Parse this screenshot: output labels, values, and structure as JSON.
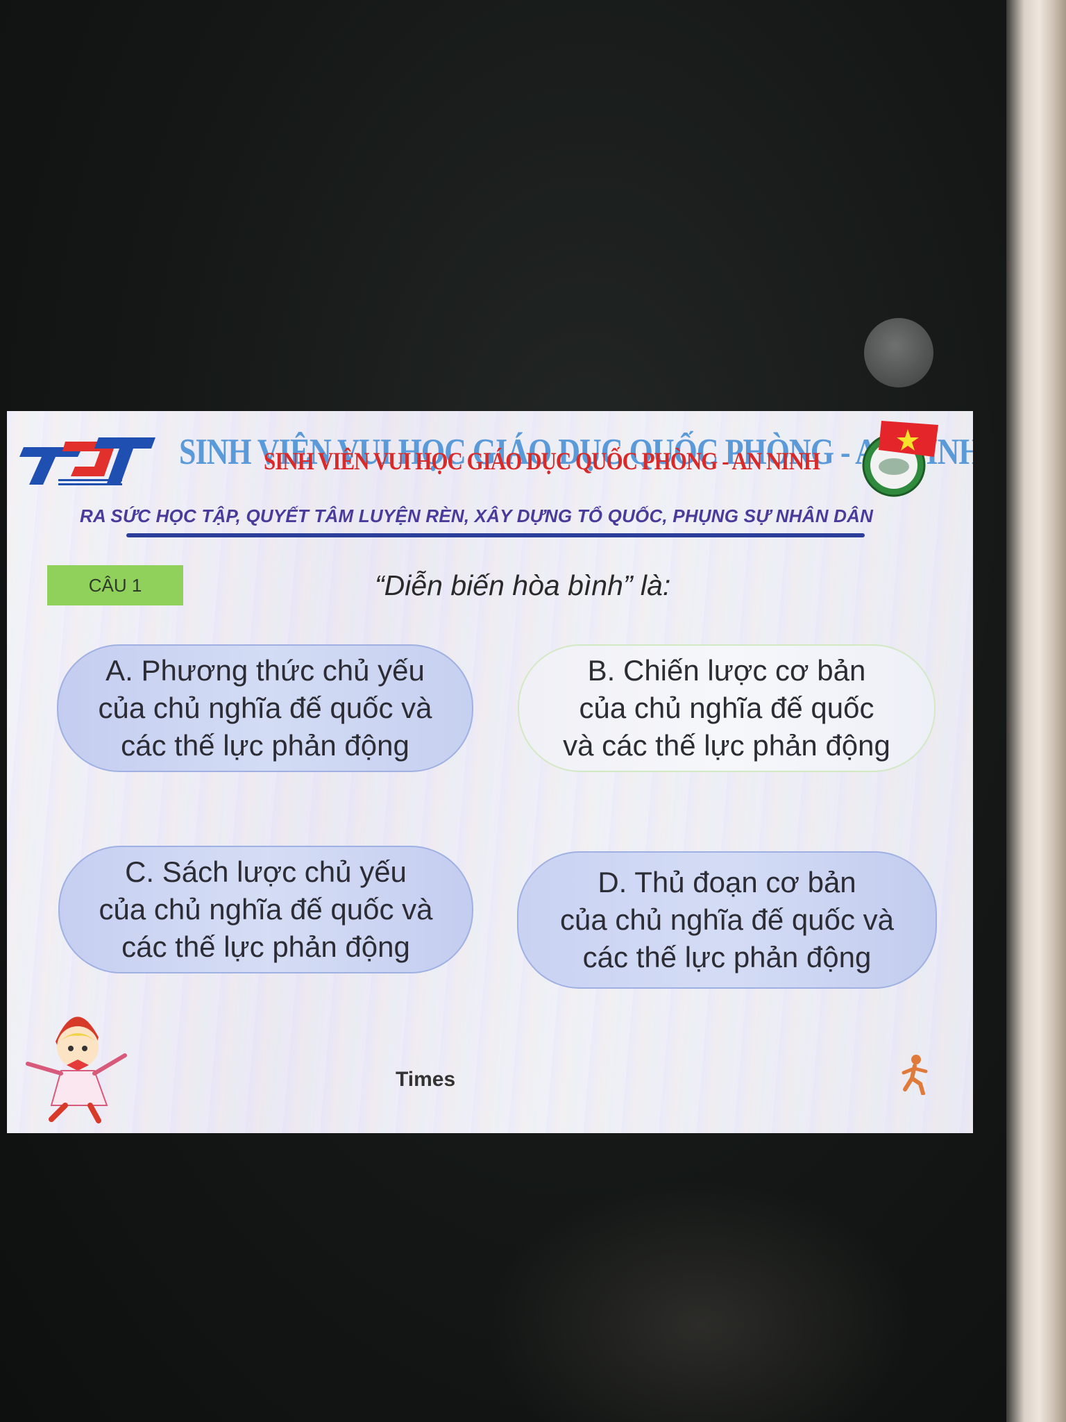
{
  "header": {
    "title": "SINH VIÊN VUI HỌC GIÁO DỤC QUỐC PHÒNG - AN NINH",
    "slogan": "RA SỨC HỌC TẬP, QUYẾT TÂM LUYỆN RÈN, XÂY DỰNG TỔ QUỐC, PHỤNG SỰ NHÂN DÂN",
    "logo": "TDT",
    "emblem_icon": "youth-union-emblem-icon"
  },
  "question": {
    "label": "CÂU 1",
    "text": "“Diễn biến hòa bình” là:"
  },
  "answers": [
    {
      "lines": [
        "A. Phương thức chủ yếu",
        "của chủ nghĩa đế quốc và",
        "các thế lực phản động"
      ]
    },
    {
      "lines": [
        "B. Chiến lược cơ bản",
        "của chủ nghĩa đế quốc",
        "và các thế lực phản động"
      ]
    },
    {
      "lines": [
        "C. Sách lược chủ yếu",
        "của chủ nghĩa đế quốc và",
        "các thế lực phản động"
      ]
    },
    {
      "lines": [
        "D. Thủ đoạn cơ bản",
        "của chủ nghĩa đế quốc và",
        "các thế lực phản động"
      ]
    }
  ],
  "footer": {
    "timer_label": "Times"
  },
  "colors": {
    "badge": "#8fd15a",
    "title_blue": "#5a9ad8",
    "title_red": "#d92a2a",
    "slogan": "#4a3b9a",
    "answer_fill": "#cdd6f3"
  }
}
